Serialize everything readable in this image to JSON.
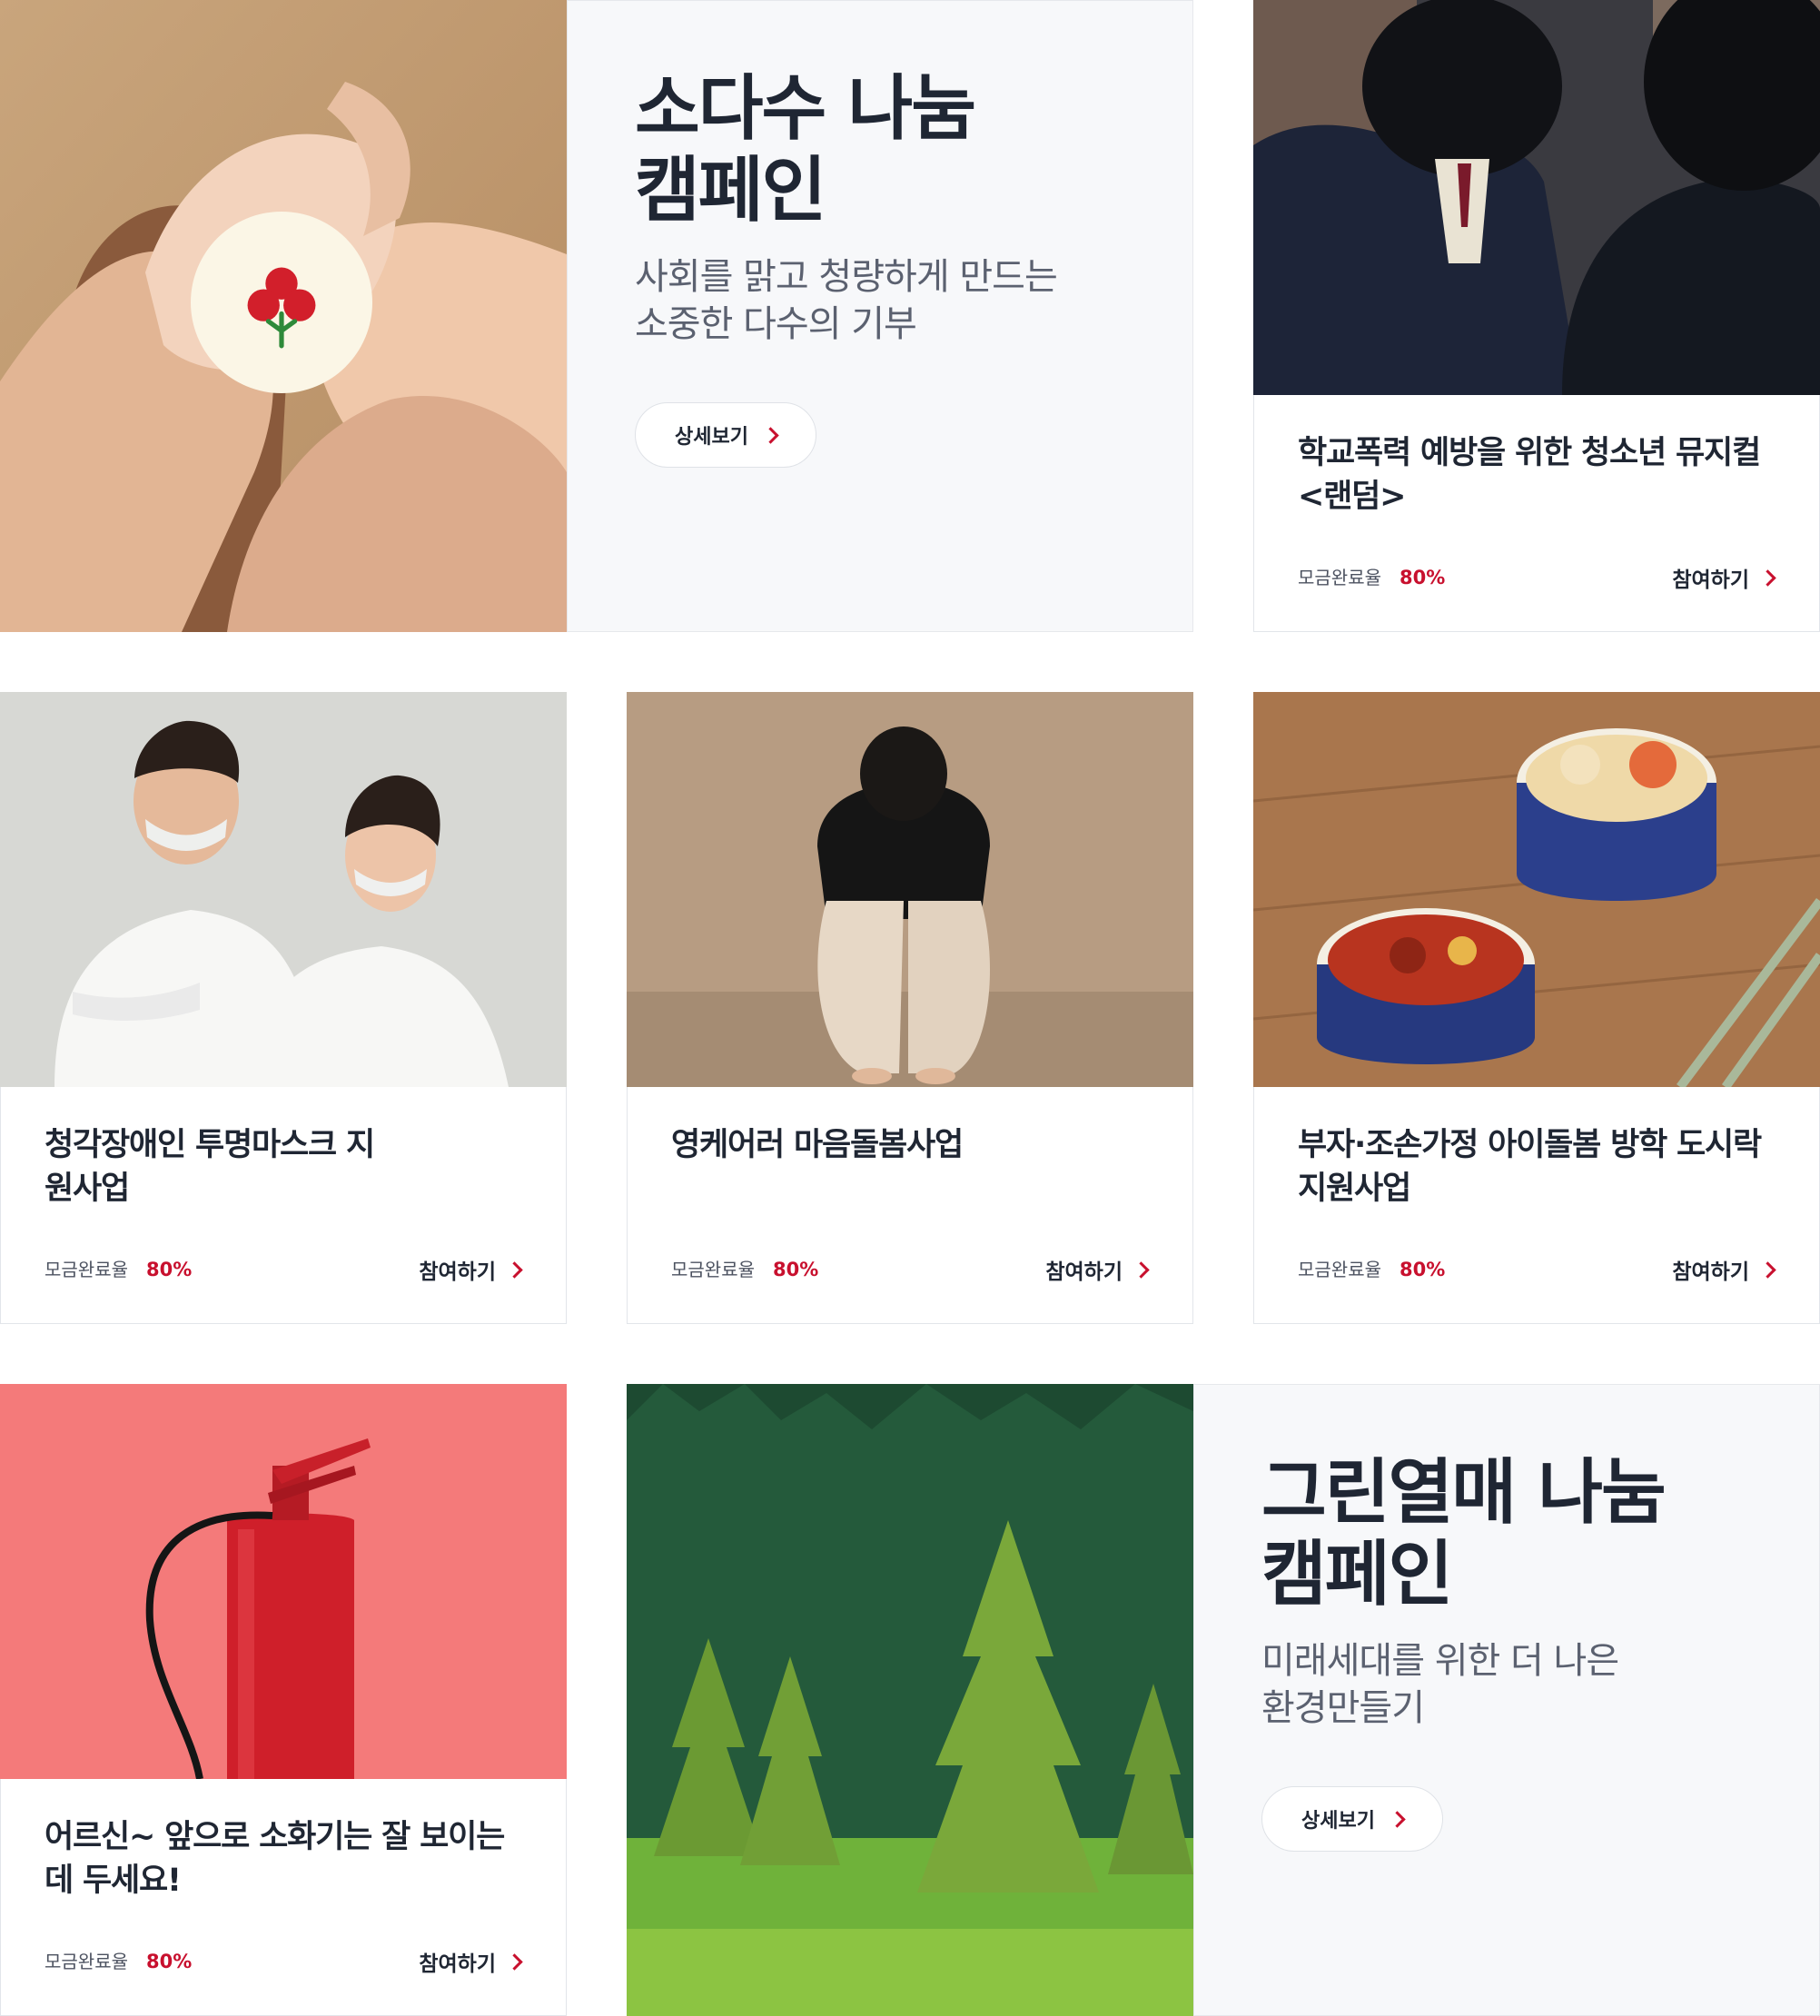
{
  "features": [
    {
      "title_line1": "소다수 나눔",
      "title_line2": "캠페인",
      "desc_line1": "사회를 맑고 청량하게 만드는",
      "desc_line2": "소중한 다수의 기부",
      "button_label": "상세보기"
    },
    {
      "title_line1": "그린열매 나눔",
      "title_line2": "캠페인",
      "desc_line1": "미래세대를 위한 더 나은",
      "desc_line2": "환경만들기",
      "button_label": "상세보기"
    }
  ],
  "cards": [
    {
      "title": "학교폭력 예방을 위한 청소년 뮤지컬 <랜덤>",
      "rate_label": "모금완료율",
      "rate_value": "80%",
      "progress": 0.8,
      "join_label": "참여하기"
    },
    {
      "title": "청각장애인 투명마스크 지원사업",
      "rate_label": "모금완료율",
      "rate_value": "80%",
      "progress": 0.8,
      "join_label": "참여하기"
    },
    {
      "title": "영케어러 마음돌봄사업",
      "rate_label": "모금완료율",
      "rate_value": "80%",
      "progress": 0.8,
      "join_label": "참여하기"
    },
    {
      "title": "부자·조손가정 아이돌봄 방학 도시락 지원사업",
      "rate_label": "모금완료율",
      "rate_value": "80%",
      "progress": 0.8,
      "join_label": "참여하기"
    },
    {
      "title": "어르신~ 앞으로 소화기는 잘 보이는 데 두세요!",
      "rate_label": "모금완료율",
      "rate_value": "80%",
      "progress": 0.8,
      "join_label": "참여하기"
    }
  ],
  "icons": {
    "detail": "chevron-right-icon",
    "join": "chevron-right-icon",
    "logo": "red-fruit-logo-icon"
  },
  "colors": {
    "accent": "#c8102e",
    "title": "#1f2633",
    "panel_bg": "#f7f8fa"
  }
}
